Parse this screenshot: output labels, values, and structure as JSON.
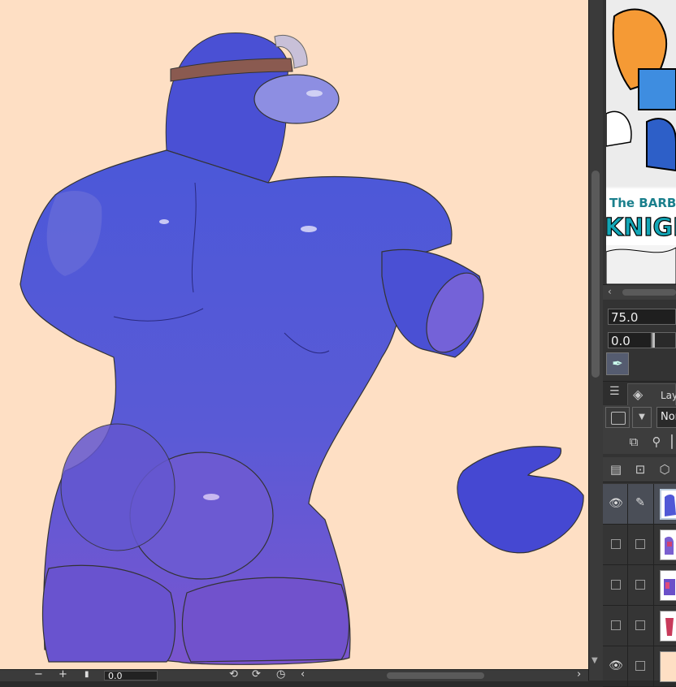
{
  "navigator": {
    "comic_title_line1": "The BARB",
    "comic_title_line2": "KNIGH",
    "zoom_value": "75.0",
    "rotation_value": "0.0"
  },
  "bottom_bar": {
    "zoom_out": "−",
    "zoom_in": "+",
    "rotation_value": "0.0"
  },
  "layer_panel": {
    "tab_label": "Lay",
    "blend_mode": "Nor",
    "layers": [
      {
        "visible": true,
        "selected": true
      },
      {
        "visible": false,
        "selected": false
      },
      {
        "visible": false,
        "selected": false
      },
      {
        "visible": false,
        "selected": false
      },
      {
        "visible": true,
        "selected": false
      }
    ]
  },
  "colors": {
    "canvas_bg": "#fedfc4",
    "body_main": "#5058d6",
    "body_dark": "#3a3ec0",
    "belt": "#8a5a50",
    "panel_bg": "#333333"
  }
}
